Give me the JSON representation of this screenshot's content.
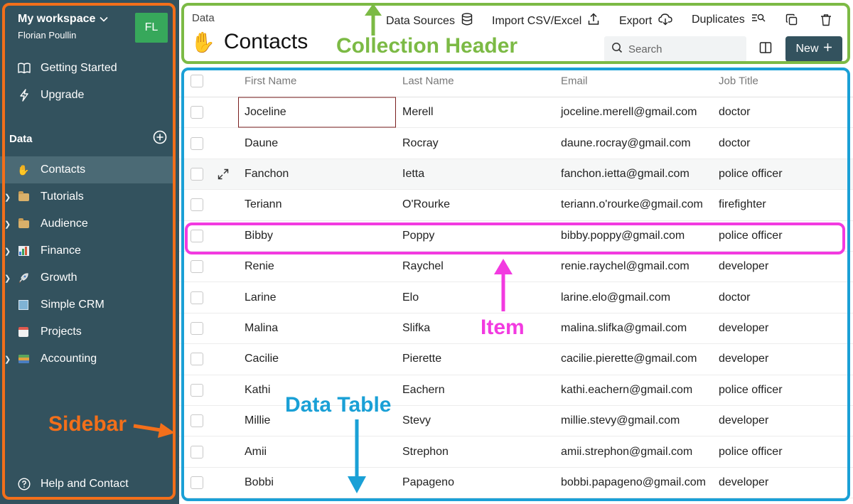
{
  "sidebar": {
    "workspace": "My workspace",
    "user": "Florian Poullin",
    "avatar_initials": "FL",
    "getting_started": "Getting Started",
    "upgrade": "Upgrade",
    "data_heading": "Data",
    "collections": [
      {
        "label": "Contacts",
        "icon": "waving-hand-icon",
        "expandable": false,
        "active": true
      },
      {
        "label": "Tutorials",
        "icon": "folder-icon",
        "expandable": true
      },
      {
        "label": "Audience",
        "icon": "folder-icon",
        "expandable": true
      },
      {
        "label": "Finance",
        "icon": "bar-chart-icon",
        "expandable": true
      },
      {
        "label": "Growth",
        "icon": "rocket-icon",
        "expandable": true
      },
      {
        "label": "Simple CRM",
        "icon": "office-building-icon",
        "expandable": false
      },
      {
        "label": "Projects",
        "icon": "calendar-icon",
        "expandable": false
      },
      {
        "label": "Accounting",
        "icon": "books-icon",
        "expandable": true
      }
    ],
    "help": "Help and Contact"
  },
  "header": {
    "breadcrumb": "Data",
    "title": "Contacts",
    "toolbar": {
      "data_sources": "Data Sources",
      "import": "Import CSV/Excel",
      "export": "Export",
      "duplicates": "Duplicates"
    },
    "search_placeholder": "Search",
    "new_button": "New"
  },
  "table": {
    "columns": [
      "First Name",
      "Last Name",
      "Email",
      "Job Title"
    ],
    "rows": [
      [
        "Joceline",
        "Merell",
        "joceline.merell@gmail.com",
        "doctor"
      ],
      [
        "Daune",
        "Rocray",
        "daune.rocray@gmail.com",
        "doctor"
      ],
      [
        "Fanchon",
        "Ietta",
        "fanchon.ietta@gmail.com",
        "police officer"
      ],
      [
        "Teriann",
        "O'Rourke",
        "teriann.o'rourke@gmail.com",
        "firefighter"
      ],
      [
        "Bibby",
        "Poppy",
        "bibby.poppy@gmail.com",
        "police officer"
      ],
      [
        "Renie",
        "Raychel",
        "renie.raychel@gmail.com",
        "developer"
      ],
      [
        "Larine",
        "Elo",
        "larine.elo@gmail.com",
        "doctor"
      ],
      [
        "Malina",
        "Slifka",
        "malina.slifka@gmail.com",
        "developer"
      ],
      [
        "Cacilie",
        "Pierette",
        "cacilie.pierette@gmail.com",
        "developer"
      ],
      [
        "Kathi",
        "Eachern",
        "kathi.eachern@gmail.com",
        "police officer"
      ],
      [
        "Millie",
        "Stevy",
        "millie.stevy@gmail.com",
        "developer"
      ],
      [
        "Amii",
        "Strephon",
        "amii.strephon@gmail.com",
        "police officer"
      ],
      [
        "Bobbi",
        "Papageno",
        "bobbi.papageno@gmail.com",
        "developer"
      ]
    ]
  },
  "annotations": {
    "collection_header": "Collection Header",
    "item": "Item",
    "data_table": "Data Table",
    "sidebar": "Sidebar"
  },
  "colors": {
    "sidebar_bg": "#33525e",
    "avatar_bg": "#37a85b",
    "annotation_orange": "#f36f1a",
    "annotation_green": "#7cba45",
    "annotation_blue": "#1aa0d6",
    "annotation_magenta": "#f23ae0"
  }
}
